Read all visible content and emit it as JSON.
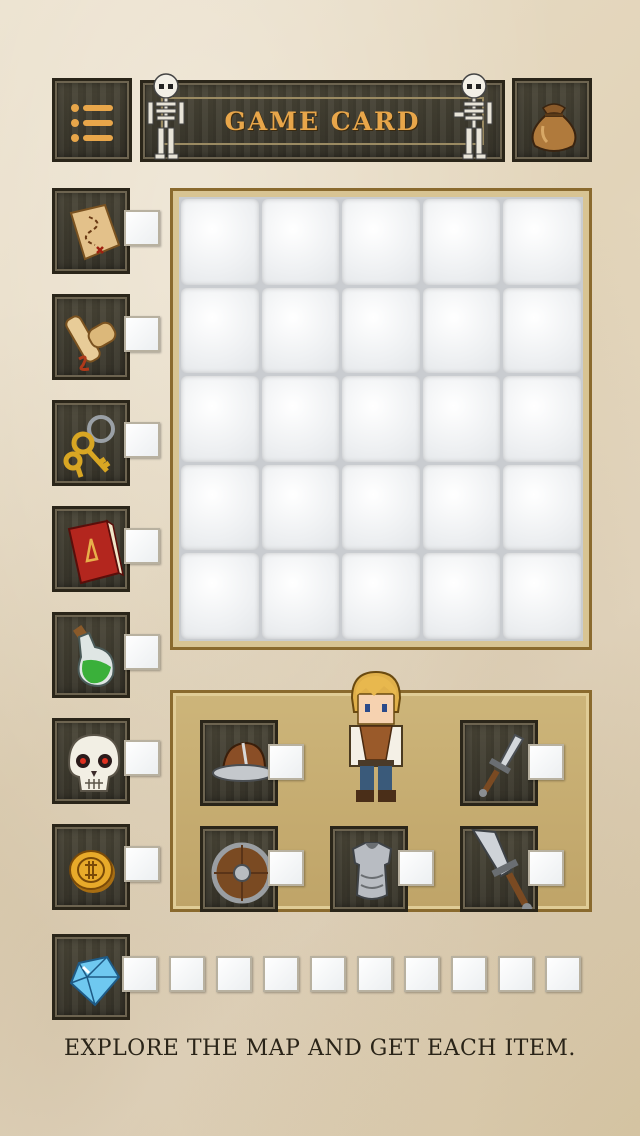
{
  "header": {
    "title": "GAME CARD",
    "menu_icon": "menu-list-icon",
    "bag_icon": "coin-bag-icon"
  },
  "inventory": {
    "items": [
      {
        "name": "treasure-map",
        "icon": "map-icon",
        "checked": false
      },
      {
        "name": "scroll",
        "icon": "scroll-icon",
        "checked": false
      },
      {
        "name": "keys",
        "icon": "keys-icon",
        "checked": false
      },
      {
        "name": "spellbook",
        "icon": "book-icon",
        "checked": false
      },
      {
        "name": "potion",
        "icon": "potion-icon",
        "checked": false
      },
      {
        "name": "skull",
        "icon": "skull-icon",
        "checked": false
      },
      {
        "name": "gold-coin",
        "icon": "coin-icon",
        "checked": false
      }
    ],
    "gems": {
      "icon": "gem-icon",
      "count": 10,
      "collected": 0
    }
  },
  "map": {
    "rows": 5,
    "cols": 5
  },
  "equipment": {
    "hero_icon": "hero-icon",
    "items": [
      {
        "name": "helmet",
        "icon": "helmet-icon"
      },
      {
        "name": "dagger",
        "icon": "dagger-icon"
      },
      {
        "name": "shield",
        "icon": "shield-icon"
      },
      {
        "name": "armor",
        "icon": "armor-icon"
      },
      {
        "name": "sword",
        "icon": "sword-icon"
      }
    ]
  },
  "footer": {
    "instruction": "EXPLORE THE MAP AND GET EACH ITEM."
  },
  "colors": {
    "title_text": "#e8a64a",
    "wood": "#3f3b30",
    "panel": "#c9af72",
    "frame": "#8a6a2e"
  }
}
